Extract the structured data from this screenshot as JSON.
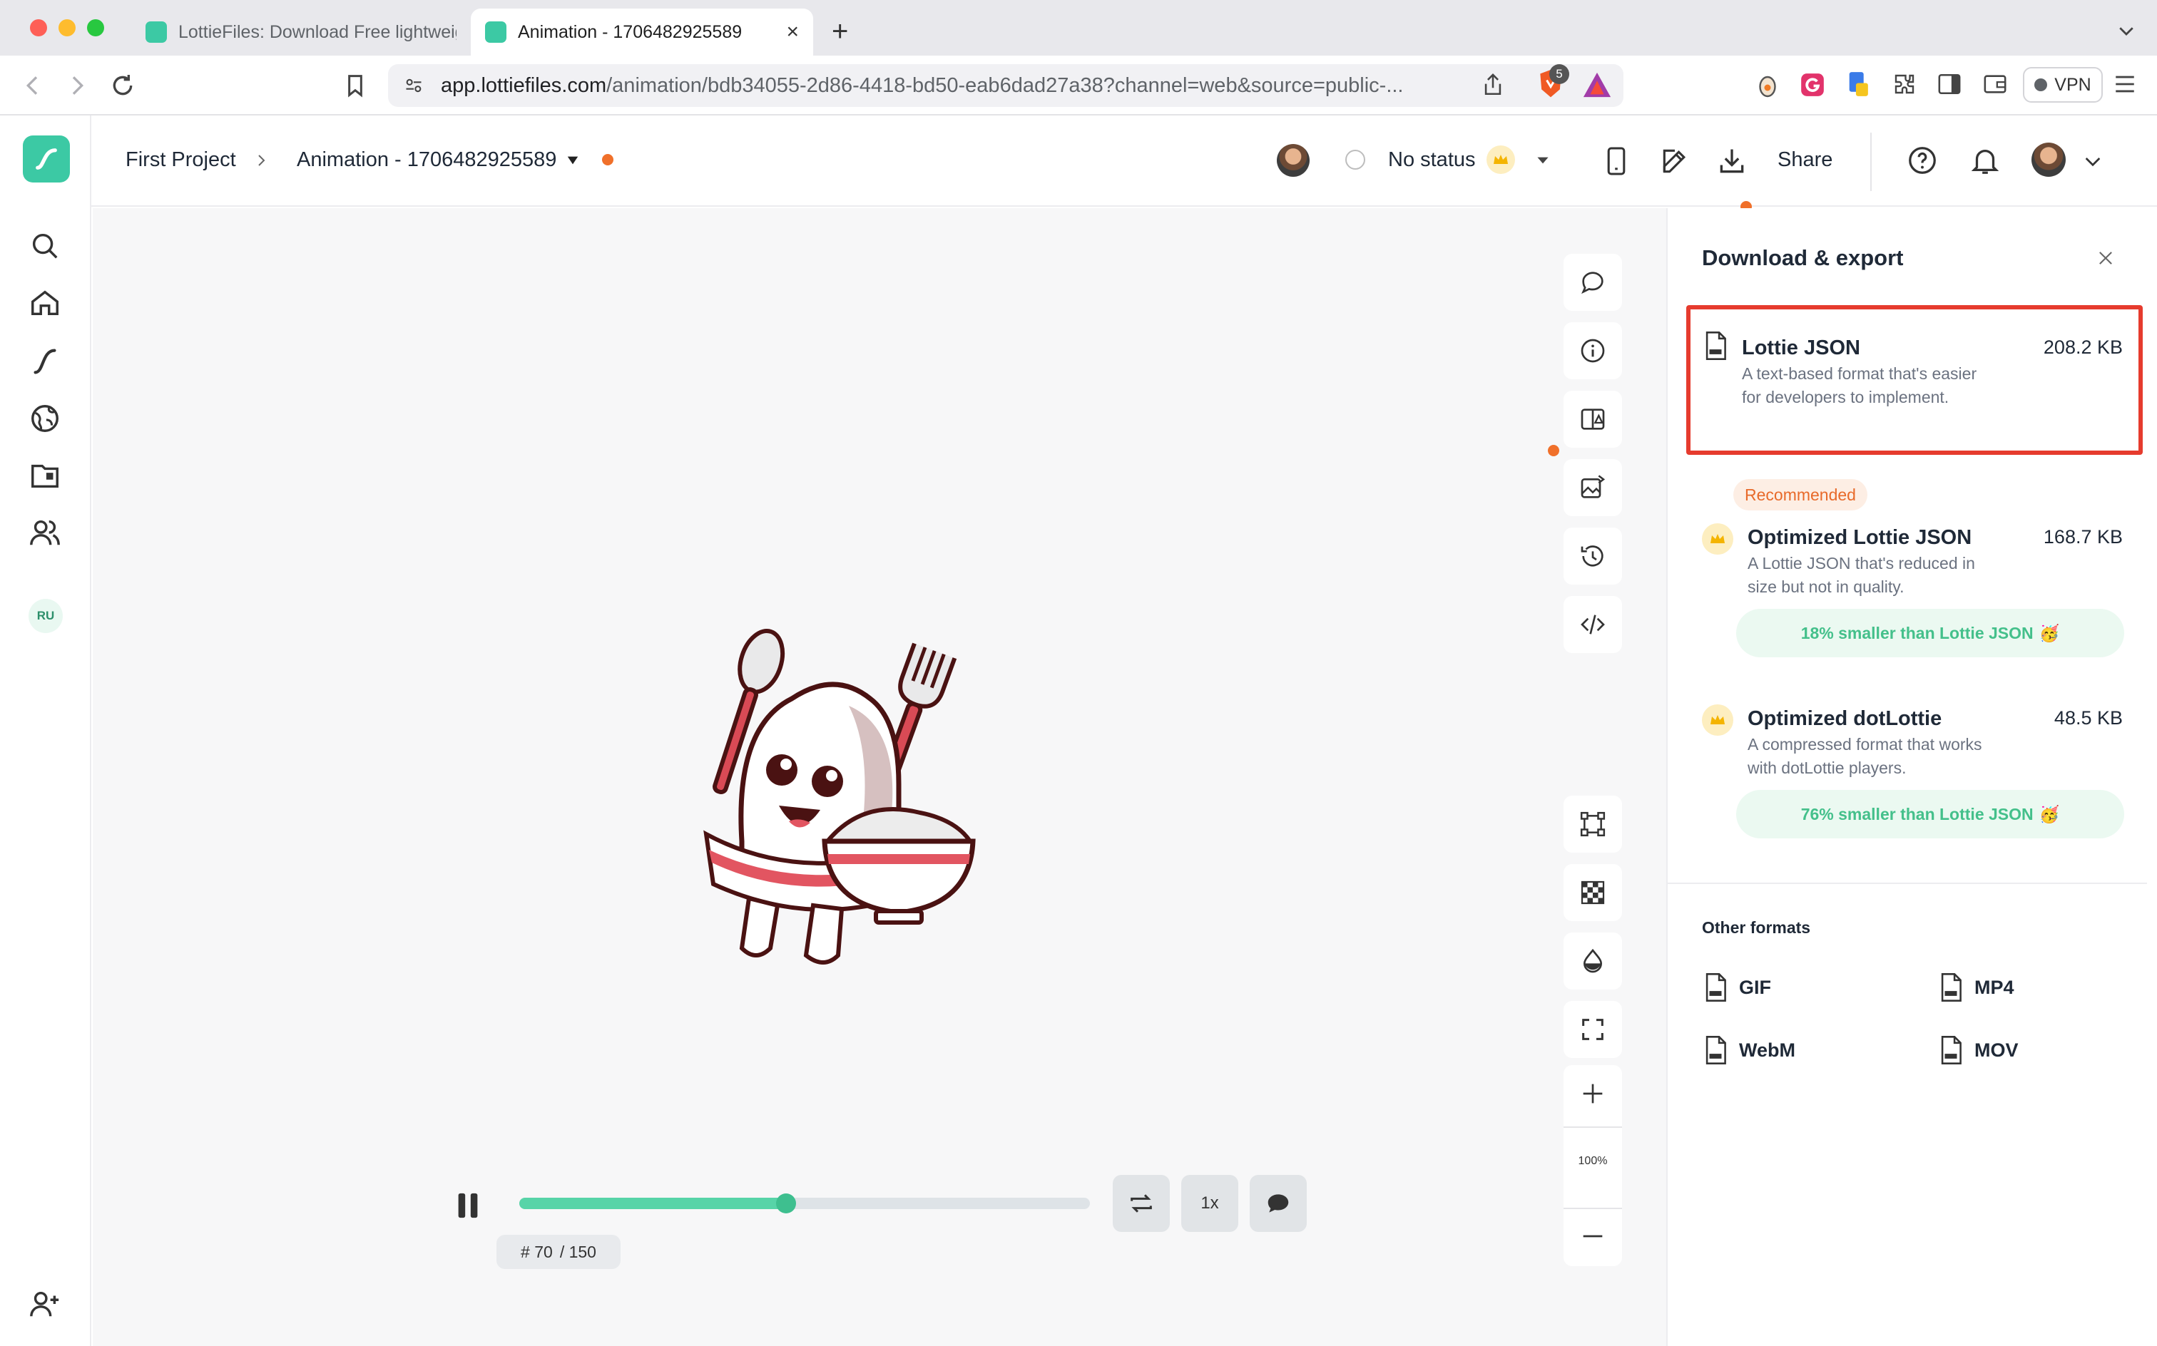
{
  "browser": {
    "tabs": [
      {
        "title": "LottieFiles: Download Free lightweight animations",
        "active": false
      },
      {
        "title": "Animation - 1706482925589",
        "active": true
      }
    ],
    "url_host": "app.lottiefiles.com",
    "url_path": "/animation/bdb34055-2d86-4418-bd50-eab6dad27a38?channel=web&source=public-...",
    "brave_badge": "5",
    "vpn_label": "VPN"
  },
  "sidebar": {
    "workspace_badge": "RU",
    "accent": "#3cc9a4"
  },
  "header": {
    "breadcrumb_project": "First Project",
    "breadcrumb_sep": ">",
    "animation_name": "Animation - 1706482925589",
    "status": "No status",
    "share_label": "Share"
  },
  "canvas": {
    "zoom": "100%"
  },
  "player": {
    "frame_prefix": "#",
    "current_frame": "70",
    "total_frames": "/ 150",
    "progress": 0.467,
    "speed": "1x"
  },
  "panel": {
    "title": "Download & export",
    "formats": [
      {
        "name": "Lottie JSON",
        "size": "208.2 KB",
        "desc": "A text-based format that's easier for developers to implement."
      },
      {
        "name": "Optimized Lottie JSON",
        "size": "168.7 KB",
        "desc": "A Lottie JSON that's reduced in size but not in quality.",
        "savings": "18% smaller than Lottie JSON"
      },
      {
        "name": "Optimized dotLottie",
        "size": "48.5 KB",
        "desc": "A compressed format that works with dotLottie players.",
        "savings": "76% smaller than Lottie JSON"
      }
    ],
    "recommended_label": "Recommended",
    "other_formats_title": "Other formats",
    "other_formats": [
      "GIF",
      "MP4",
      "WebM",
      "MOV"
    ],
    "highlight_color": "#e63b2e"
  }
}
